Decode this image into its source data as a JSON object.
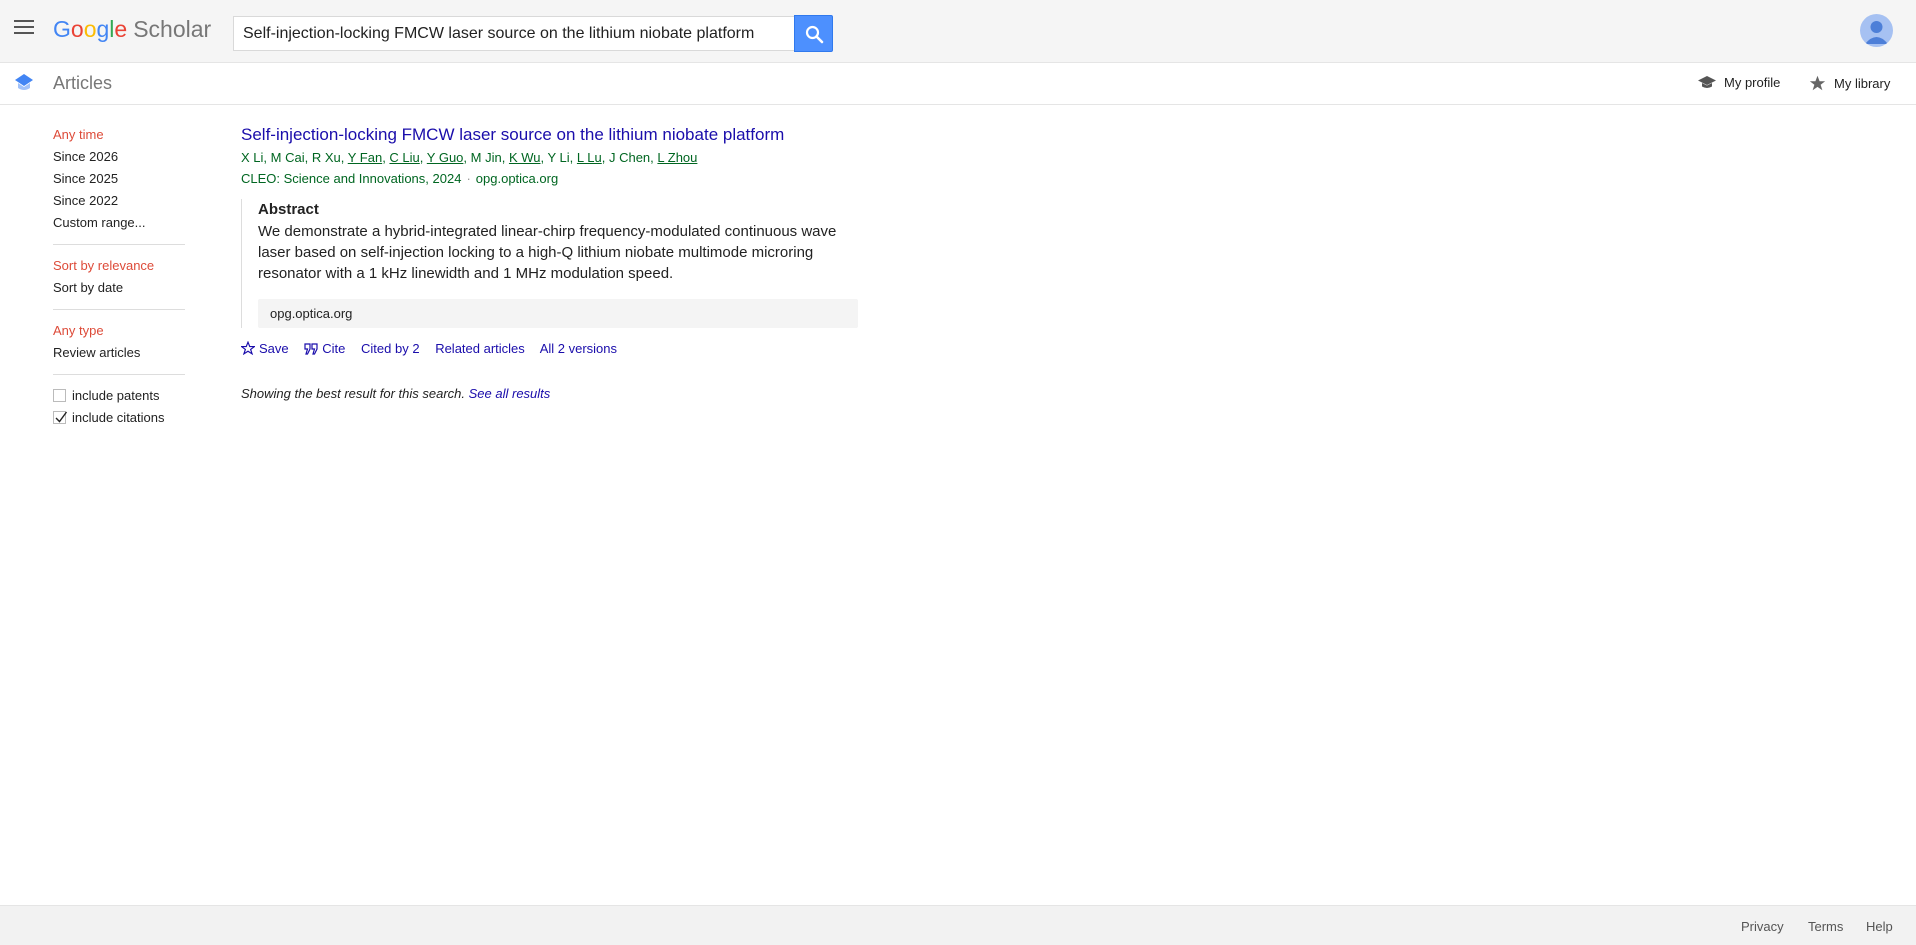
{
  "header": {
    "logo_letters": [
      "G",
      "o",
      "o",
      "g",
      "l",
      "e"
    ],
    "logo_suffix": "Scholar",
    "search_value": "Self-injection-locking FMCW laser source on the lithium niobate platform"
  },
  "subheader": {
    "title": "Articles",
    "my_profile": "My profile",
    "my_library": "My library"
  },
  "sidebar": {
    "time_filters": [
      "Any time",
      "Since 2026",
      "Since 2025",
      "Since 2022",
      "Custom range..."
    ],
    "sort_options": [
      "Sort by relevance",
      "Sort by date"
    ],
    "type_options": [
      "Any type",
      "Review articles"
    ],
    "include_patents": {
      "label": "include patents",
      "checked": false
    },
    "include_citations": {
      "label": "include citations",
      "checked": true
    }
  },
  "result": {
    "title": "Self-injection-locking FMCW laser source on the lithium niobate platform",
    "authors": [
      {
        "name": "X Li",
        "link": false
      },
      {
        "name": "M Cai",
        "link": false
      },
      {
        "name": "R Xu",
        "link": false
      },
      {
        "name": "Y Fan",
        "link": true
      },
      {
        "name": "C Liu",
        "link": true
      },
      {
        "name": "Y Guo",
        "link": true
      },
      {
        "name": "M Jin",
        "link": false
      },
      {
        "name": "K Wu",
        "link": true
      },
      {
        "name": "Y Li",
        "link": false
      },
      {
        "name": "L Lu",
        "link": true
      },
      {
        "name": "J Chen",
        "link": false
      },
      {
        "name": "L Zhou",
        "link": true
      }
    ],
    "venue": "CLEO: Science and Innovations, 2024",
    "source_domain": "opg.optica.org",
    "abstract_heading": "Abstract",
    "abstract_text": "We demonstrate a hybrid-integrated linear-chirp frequency-modulated continuous wave laser based on self-injection locking to a high-Q lithium niobate multimode microring resonator with a 1 kHz linewidth and 1 MHz modulation speed.",
    "source_box": "opg.optica.org",
    "actions": {
      "save": "Save",
      "cite": "Cite",
      "cited_by": "Cited by 2",
      "related": "Related articles",
      "versions": "All 2 versions"
    }
  },
  "notice": {
    "text": "Showing the best result for this search.",
    "link": "See all results"
  },
  "footer": {
    "privacy": "Privacy",
    "terms": "Terms",
    "help": "Help"
  }
}
